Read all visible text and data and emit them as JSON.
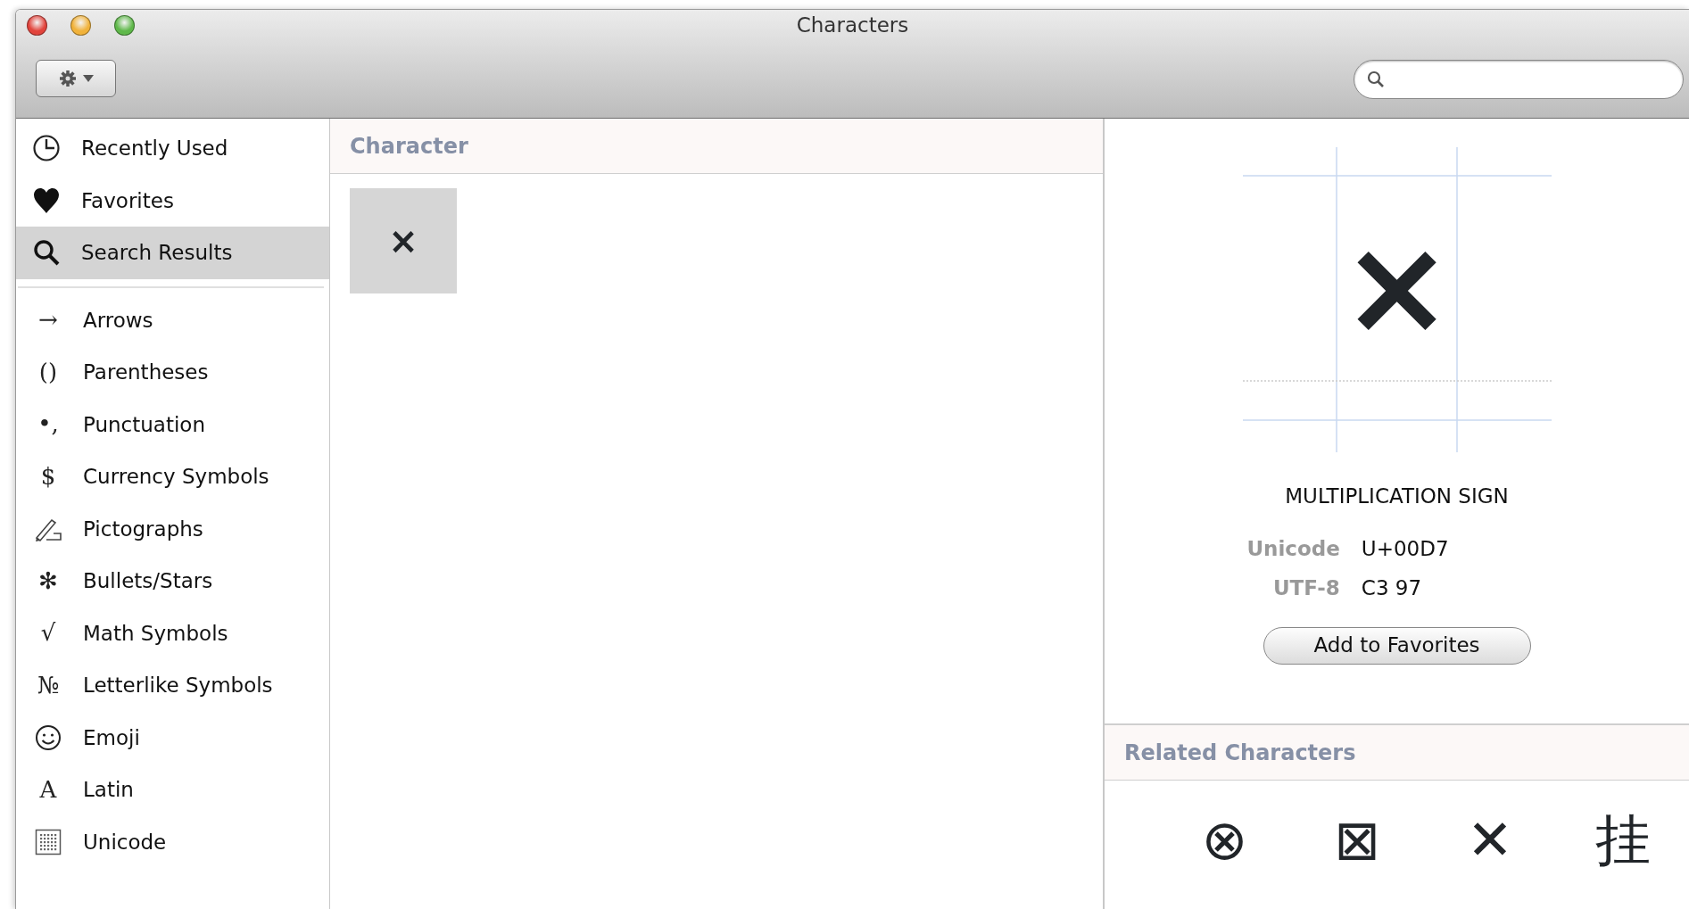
{
  "window": {
    "title": "Characters"
  },
  "sidebar": {
    "groups": [
      {
        "items": [
          {
            "label": "Recently Used",
            "selected": false
          },
          {
            "label": "Favorites",
            "selected": false
          },
          {
            "label": "Search Results",
            "selected": true
          }
        ]
      },
      {
        "items": [
          {
            "label": "Arrows",
            "glyph": "→",
            "selected": false
          },
          {
            "label": "Parentheses",
            "glyph": "()",
            "selected": false
          },
          {
            "label": "Punctuation",
            "glyph": "•,",
            "selected": false
          },
          {
            "label": "Currency Symbols",
            "glyph": "$",
            "selected": false
          },
          {
            "label": "Pictographs",
            "selected": false
          },
          {
            "label": "Bullets/Stars",
            "glyph": "✻",
            "selected": false
          },
          {
            "label": "Math Symbols",
            "glyph": "√",
            "selected": false
          },
          {
            "label": "Letterlike Symbols",
            "glyph": "№",
            "selected": false
          },
          {
            "label": "Emoji",
            "selected": false
          },
          {
            "label": "Latin",
            "glyph": "A",
            "selected": false
          },
          {
            "label": "Unicode",
            "selected": false
          }
        ]
      }
    ]
  },
  "results": {
    "header": "Character",
    "characters": [
      {
        "char": "×",
        "selected": true
      }
    ]
  },
  "detail": {
    "preview": "×",
    "name": "MULTIPLICATION SIGN",
    "fields": [
      {
        "label": "Unicode",
        "value": "U+00D7"
      },
      {
        "label": "UTF-8",
        "value": "C3 97"
      }
    ],
    "button": "Add to Favorites",
    "related_header": "Related Characters",
    "related": [
      "⊗",
      "⊠",
      "✕",
      "挂"
    ]
  }
}
